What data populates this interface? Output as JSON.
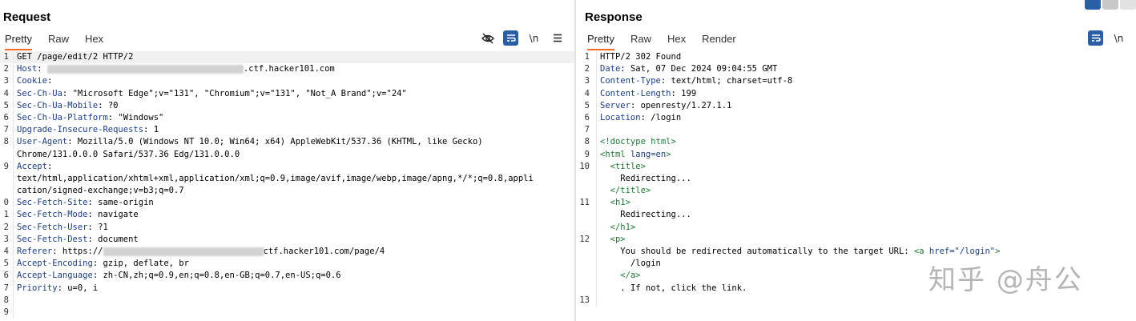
{
  "request": {
    "title": "Request",
    "tabs": [
      {
        "label": "Pretty",
        "active": true
      },
      {
        "label": "Raw",
        "active": false
      },
      {
        "label": "Hex",
        "active": false
      }
    ],
    "icons": [
      "eye-off-icon",
      "wrap-icon",
      "newline-toggle-icon",
      "menu-icon"
    ],
    "newline_label": "\\n",
    "lines": [
      {
        "n": "1",
        "text": "GET /page/edit/2 HTTP/2"
      },
      {
        "n": "2",
        "key": "Host",
        "blur": true,
        "value": ".ctf.hacker101.com"
      },
      {
        "n": "3",
        "key": "Cookie",
        "value": ""
      },
      {
        "n": "4",
        "key": "Sec-Ch-Ua",
        "value": "\"Microsoft Edge\";v=\"131\", \"Chromium\";v=\"131\", \"Not_A Brand\";v=\"24\""
      },
      {
        "n": "5",
        "key": "Sec-Ch-Ua-Mobile",
        "value": "?0"
      },
      {
        "n": "6",
        "key": "Sec-Ch-Ua-Platform",
        "value": "\"Windows\""
      },
      {
        "n": "7",
        "key": "Upgrade-Insecure-Requests",
        "value": "1"
      },
      {
        "n": "8",
        "key": "User-Agent",
        "value": "Mozilla/5.0 (Windows NT 10.0; Win64; x64) AppleWebKit/537.36 (KHTML, like Gecko)"
      },
      {
        "n": "",
        "text": "Chrome/131.0.0.0 Safari/537.36 Edg/131.0.0.0"
      },
      {
        "n": "9",
        "key": "Accept",
        "value": ""
      },
      {
        "n": "",
        "text": "text/html,application/xhtml+xml,application/xml;q=0.9,image/avif,image/webp,image/apng,*/*;q=0.8,appli"
      },
      {
        "n": "",
        "text": "cation/signed-exchange;v=b3;q=0.7"
      },
      {
        "n": "0",
        "key": "Sec-Fetch-Site",
        "value": "same-origin"
      },
      {
        "n": "1",
        "key": "Sec-Fetch-Mode",
        "value": "navigate"
      },
      {
        "n": "2",
        "key": "Sec-Fetch-User",
        "value": "?1"
      },
      {
        "n": "3",
        "key": "Sec-Fetch-Dest",
        "value": "document"
      },
      {
        "n": "4",
        "key": "Referer",
        "value": "https://",
        "blur": true,
        "value2": "ctf.hacker101.com/page/4"
      },
      {
        "n": "5",
        "key": "Accept-Encoding",
        "value": "gzip, deflate, br"
      },
      {
        "n": "6",
        "key": "Accept-Language",
        "value": "zh-CN,zh;q=0.9,en;q=0.8,en-GB;q=0.7,en-US;q=0.6"
      },
      {
        "n": "7",
        "key": "Priority",
        "value": "u=0, i"
      },
      {
        "n": "8",
        "text": ""
      },
      {
        "n": "9",
        "text": ""
      }
    ]
  },
  "response": {
    "title": "Response",
    "tabs": [
      {
        "label": "Pretty",
        "active": true
      },
      {
        "label": "Raw",
        "active": false
      },
      {
        "label": "Hex",
        "active": false
      },
      {
        "label": "Render",
        "active": false
      }
    ],
    "icons": [
      "wrap-icon",
      "newline-toggle-icon"
    ],
    "newline_label": "\\n",
    "lines": [
      {
        "n": "1",
        "text": "HTTP/2 302 Found"
      },
      {
        "n": "2",
        "key": "Date",
        "value": "Sat, 07 Dec 2024 09:04:55 GMT"
      },
      {
        "n": "3",
        "key": "Content-Type",
        "value": "text/html; charset=utf-8"
      },
      {
        "n": "4",
        "key": "Content-Length",
        "value": "199"
      },
      {
        "n": "5",
        "key": "Server",
        "value": "openresty/1.27.1.1"
      },
      {
        "n": "6",
        "key": "Location",
        "value": "/login"
      },
      {
        "n": "7",
        "text": ""
      },
      {
        "n": "8",
        "tag": "<!doctype html>"
      },
      {
        "n": "9",
        "tag": "<html ",
        "attr": "lang=en",
        "tagend": ">"
      },
      {
        "n": "10",
        "indent": "  ",
        "tag": "<title>"
      },
      {
        "n": "",
        "indent": "    ",
        "text": "Redirecting..."
      },
      {
        "n": "",
        "indent": "  ",
        "tag": "</title>"
      },
      {
        "n": "11",
        "indent": "  ",
        "tag": "<h1>"
      },
      {
        "n": "",
        "indent": "    ",
        "text": "Redirecting..."
      },
      {
        "n": "",
        "indent": "  ",
        "tag": "</h1>"
      },
      {
        "n": "12",
        "indent": "  ",
        "tag": "<p>"
      },
      {
        "n": "",
        "indent": "    ",
        "text": "You should be redirected automatically to the target URL: ",
        "tag2": "<a ",
        "attr": "href=\"/login\"",
        "tagend": ">"
      },
      {
        "n": "",
        "indent": "      ",
        "text": "/login"
      },
      {
        "n": "",
        "indent": "    ",
        "tag": "</a>"
      },
      {
        "n": "",
        "indent": "    ",
        "text": ". If not, click the link."
      },
      {
        "n": "13",
        "text": ""
      }
    ]
  },
  "watermark": "知乎 @舟公",
  "colors": {
    "accent_tab": "#ff6a20",
    "icon_blue": "#2a5fa6",
    "header_key": "#1a3d8a",
    "html_tag": "#1a7a35"
  }
}
